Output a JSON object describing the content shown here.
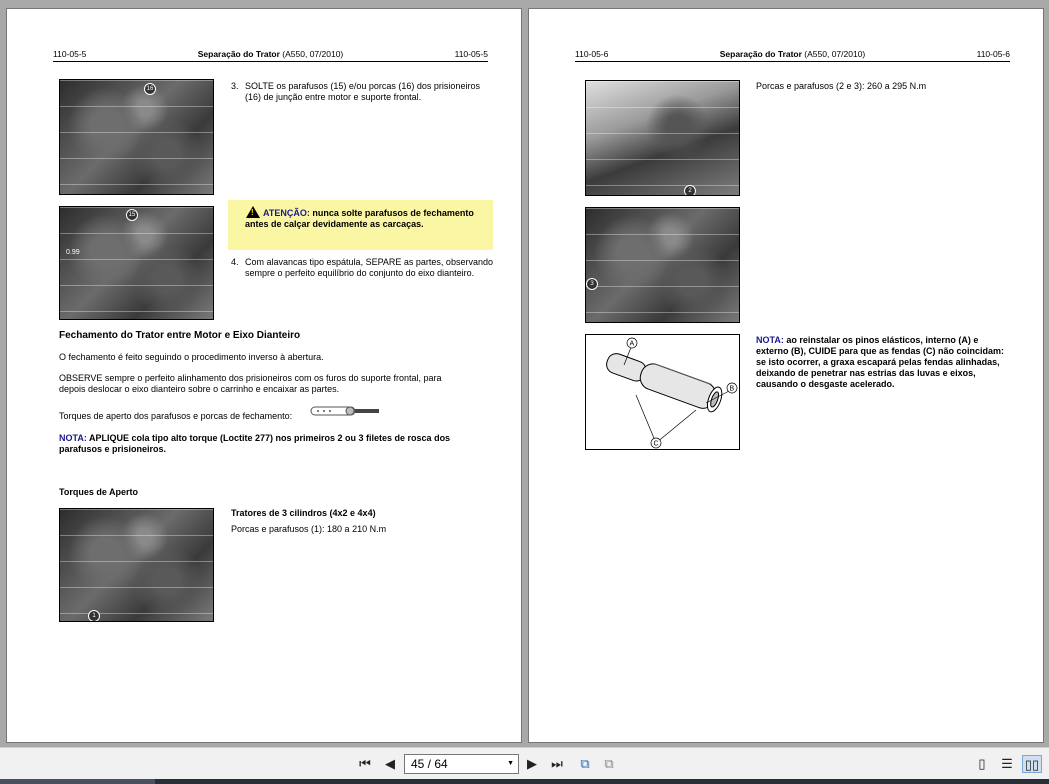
{
  "left_page": {
    "header": {
      "left": "110-05-5",
      "title": "Separação do Trator",
      "title_suffix": " (A550, 07/2010)",
      "right": "110-05-5"
    },
    "step3": {
      "num": "3.",
      "text": "SOLTE os parafusos (15) e/ou porcas (16) dos prisioneiros (16) de junção entre motor e suporte frontal."
    },
    "warning": {
      "label": "ATENÇÃO:",
      "text": " nunca solte parafusos de fechamento antes de calçar devidamente as carcaças."
    },
    "step4": {
      "num": "4.",
      "text": "Com alavancas tipo espátula, SEPARE as partes, observando sempre o perfeito equilíbrio do conjunto do eixo dianteiro."
    },
    "section_title": "Fechamento do Trator entre Motor e Eixo Dianteiro",
    "para1": "O fechamento é feito seguindo o procedimento inverso à abertura.",
    "para2": "OBSERVE sempre o perfeito alinhamento dos prisioneiros com os furos do suporte frontal, para depois deslocar o eixo dianteiro sobre o carrinho e encaixar as partes.",
    "para3": "Torques de aperto dos parafusos e porcas de fechamento:",
    "nota": {
      "label": "NOTA:",
      "text": " APLIQUE cola tipo alto torque (Loctite 277) nos primeiros 2 ou 3 filetes de rosca dos parafusos e prisioneiros."
    },
    "torques_title": "Torques de Aperto",
    "tractors_title": "Tratores de 3 cilindros (4x2 e 4x4)",
    "tractors_spec": "Porcas e parafusos (1): 180 a 210 N.m",
    "callouts": {
      "photo1": "16",
      "photo2": "15",
      "photo2b": "0.99",
      "photo3": "1"
    }
  },
  "right_page": {
    "header": {
      "left": "110-05-6",
      "title": "Separação do Trator",
      "title_suffix": " (A550, 07/2010)",
      "right": "110-05-6"
    },
    "spec": "Porcas e parafusos (2 e 3): 260 a 295 N.m",
    "nota": {
      "label": "NOTA:",
      "text": " ao reinstalar os pinos elásticos, interno (A) e externo (B), CUIDE para que as fendas (C) não coincidam: se isto ocorrer, a graxa escapará pelas fendas alinhadas, deixando de penetrar nas estrias das luvas e eixos, causando o desgaste acelerado."
    },
    "callouts": {
      "photo1": "2",
      "photo2": "3",
      "A": "A",
      "B": "B",
      "C": "C"
    }
  },
  "toolbar": {
    "page_indicator": "45 / 64",
    "icons": [
      "first-page-icon",
      "prev-page-icon",
      "next-page-icon",
      "last-page-icon",
      "rotate-icon",
      "copy-icon",
      "single-page-icon",
      "continuous-icon",
      "two-page-icon"
    ]
  },
  "colors": {
    "warning_bg": "#fbf6a4",
    "nota_blue": "#1a1a8c",
    "viewer_bg": "#a8a8a8"
  }
}
